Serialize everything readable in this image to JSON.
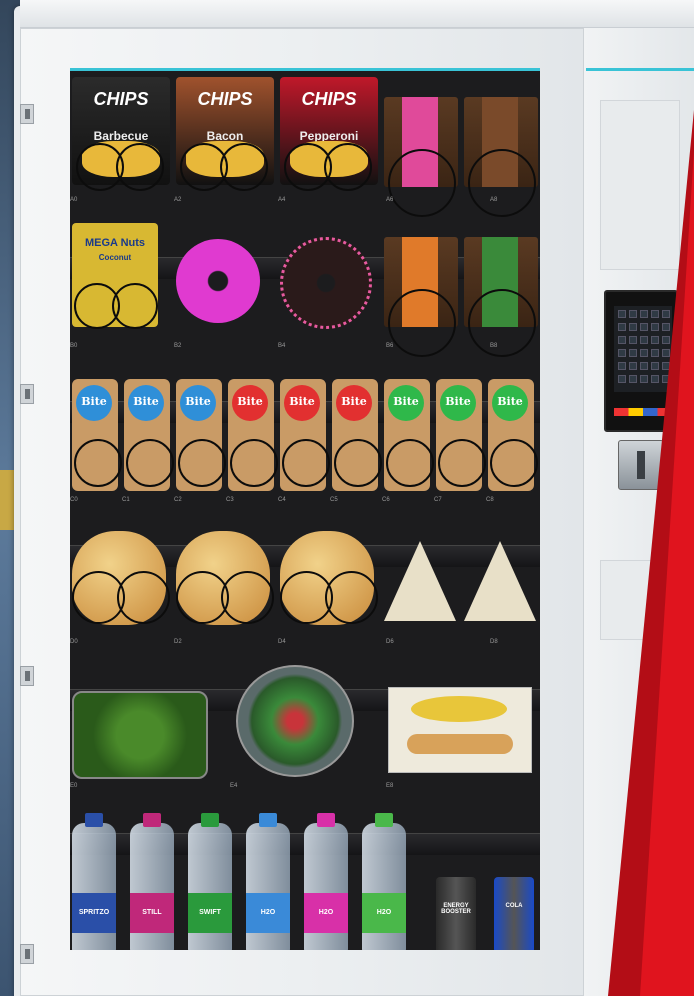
{
  "chips": [
    {
      "brand": "CHIPS",
      "flavor": "Barbecue",
      "color": "#2b2b2b"
    },
    {
      "brand": "CHIPS",
      "flavor": "Bacon",
      "color": "#a0522d"
    },
    {
      "brand": "CHIPS",
      "flavor": "Pepperoni",
      "color": "#c0182a"
    }
  ],
  "nuts": {
    "brand": "MEGA Nuts",
    "line2": "Coconut"
  },
  "bites": [
    {
      "text": "Bite",
      "color": "#2f8fd8"
    },
    {
      "text": "Bite",
      "color": "#2f8fd8"
    },
    {
      "text": "Bite",
      "color": "#2f8fd8"
    },
    {
      "text": "Bite",
      "color": "#e23030"
    },
    {
      "text": "Bite",
      "color": "#e23030"
    },
    {
      "text": "Bite",
      "color": "#e23030"
    },
    {
      "text": "Bite",
      "color": "#2fb84a"
    },
    {
      "text": "Bite",
      "color": "#2fb84a"
    },
    {
      "text": "Bite",
      "color": "#2fb84a"
    }
  ],
  "slots": {
    "row1": [
      "A0",
      "A2",
      "A4",
      "A6",
      "A8"
    ],
    "row2": [
      "B0",
      "B2",
      "B4",
      "B6",
      "B8"
    ],
    "row3": [
      "C0",
      "C1",
      "C2",
      "C3",
      "C4",
      "C5",
      "C6",
      "C7",
      "C8"
    ],
    "row4": [
      "D0",
      "D2",
      "D4",
      "D6",
      "D8"
    ],
    "row5": [
      "E0",
      "E4",
      "E8"
    ]
  },
  "bottles": [
    {
      "label": "SPRITZO",
      "color": "#2a4fa8"
    },
    {
      "label": "STILL",
      "color": "#c0287a"
    },
    {
      "label": "SWIFT",
      "color": "#2a9a3c"
    },
    {
      "label": "H2O",
      "color": "#3a8ad8"
    },
    {
      "label": "H2O",
      "color": "#d830a8"
    },
    {
      "label": "H2O",
      "color": "#4ab84a"
    }
  ],
  "cans": [
    {
      "label": "ENERGY BOOSTER",
      "color": "#2a2a2a"
    },
    {
      "label": "COLA",
      "color": "#1a4ac8"
    }
  ],
  "colors": {
    "accent": "#39c3d6",
    "brand_red": "#e0141e"
  }
}
